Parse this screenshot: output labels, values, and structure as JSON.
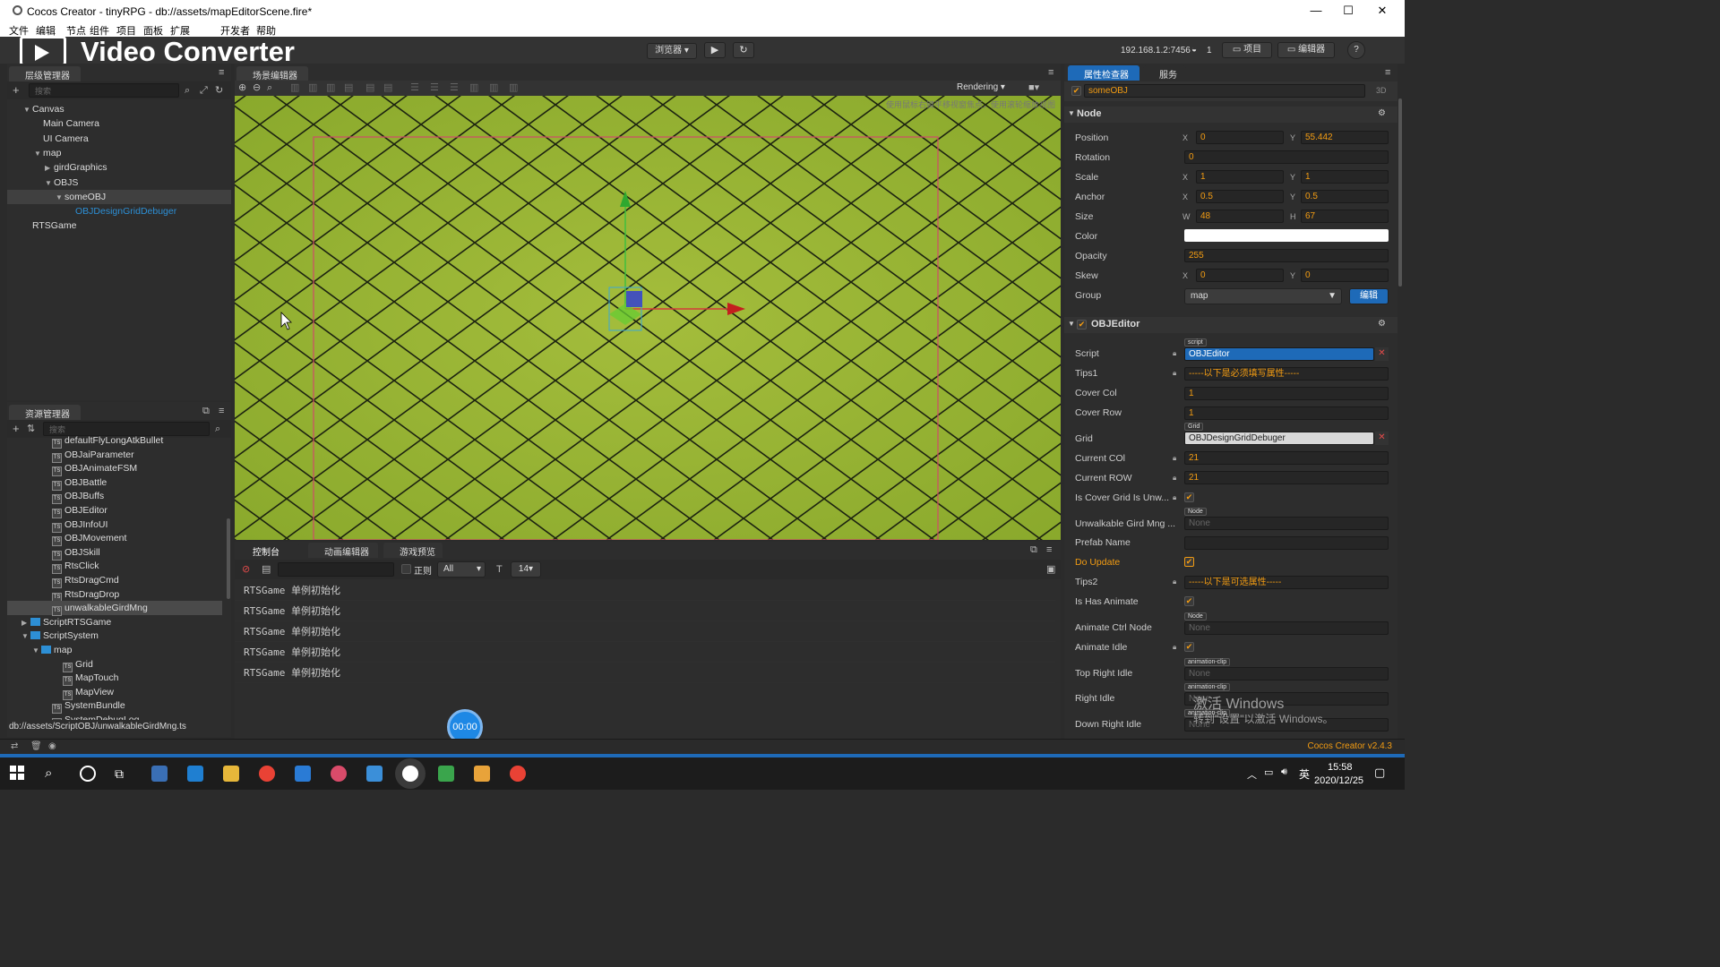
{
  "window": {
    "title": "Cocos Creator - tinyRPG - db://assets/mapEditorScene.fire*",
    "controls": [
      "—",
      "☐",
      "✕"
    ]
  },
  "menu": [
    "文件",
    "编辑",
    "节点",
    "组件",
    "项目",
    "面板",
    "扩展",
    "开发者",
    "帮助"
  ],
  "watermark": "Video Converter",
  "toolbar": {
    "browser_label": "浏览器 ▾",
    "ip": "192.168.1.2:7456",
    "ip_count": "1",
    "project_label": "项目",
    "editor_label": "编辑器",
    "help_label": "?"
  },
  "hierarchy": {
    "tab": "层级管理器",
    "search_placeholder": "搜索",
    "items": [
      {
        "label": "Canvas",
        "depth": 0,
        "arrow": "▼"
      },
      {
        "label": "Main Camera",
        "depth": 1,
        "arrow": ""
      },
      {
        "label": "UI Camera",
        "depth": 1,
        "arrow": ""
      },
      {
        "label": "map",
        "depth": 1,
        "arrow": "▼"
      },
      {
        "label": "girdGraphics",
        "depth": 2,
        "arrow": "▶"
      },
      {
        "label": "OBJS",
        "depth": 2,
        "arrow": "▼"
      },
      {
        "label": "someOBJ",
        "depth": 3,
        "arrow": "▼",
        "selected": true
      },
      {
        "label": "OBJDesignGridDebuger",
        "depth": 4,
        "arrow": "",
        "link": true
      },
      {
        "label": "RTSGame",
        "depth": 0,
        "arrow": ""
      }
    ]
  },
  "assets": {
    "tab": "资源管理器",
    "search_placeholder": "搜索",
    "items": [
      {
        "label": "defaultFlyLongAtkBullet",
        "depth": 3,
        "type": "ts"
      },
      {
        "label": "OBJaiParameter",
        "depth": 3,
        "type": "ts"
      },
      {
        "label": "OBJAnimateFSM",
        "depth": 3,
        "type": "ts"
      },
      {
        "label": "OBJBattle",
        "depth": 3,
        "type": "ts"
      },
      {
        "label": "OBJBuffs",
        "depth": 3,
        "type": "ts"
      },
      {
        "label": "OBJEditor",
        "depth": 3,
        "type": "ts"
      },
      {
        "label": "OBJInfoUI",
        "depth": 3,
        "type": "ts"
      },
      {
        "label": "OBJMovement",
        "depth": 3,
        "type": "ts"
      },
      {
        "label": "OBJSkill",
        "depth": 3,
        "type": "ts"
      },
      {
        "label": "RtsClick",
        "depth": 3,
        "type": "ts"
      },
      {
        "label": "RtsDragCmd",
        "depth": 3,
        "type": "ts"
      },
      {
        "label": "RtsDragDrop",
        "depth": 3,
        "type": "ts"
      },
      {
        "label": "unwalkableGirdMng",
        "depth": 3,
        "type": "ts",
        "selected": true
      },
      {
        "label": "ScriptRTSGame",
        "depth": 1,
        "type": "folder",
        "arrow": "▶"
      },
      {
        "label": "ScriptSystem",
        "depth": 1,
        "type": "folder",
        "arrow": "▼"
      },
      {
        "label": "map",
        "depth": 2,
        "type": "folder",
        "arrow": "▼"
      },
      {
        "label": "Grid",
        "depth": 4,
        "type": "ts"
      },
      {
        "label": "MapTouch",
        "depth": 4,
        "type": "ts"
      },
      {
        "label": "MapView",
        "depth": 4,
        "type": "ts"
      },
      {
        "label": "SystemBundle",
        "depth": 3,
        "type": "ts"
      },
      {
        "label": "SystemDebugLog",
        "depth": 3,
        "type": "ts"
      }
    ],
    "path": "db://assets/ScriptOBJ/unwalkableGirdMng.ts"
  },
  "scene": {
    "tab": "场景编辑器",
    "rendering_label": "Rendering ▾",
    "hint": "使用鼠标右键平移视窗焦点，使用滚轮缩放视图"
  },
  "console": {
    "tabs": [
      "控制台",
      "动画编辑器",
      "游戏预览"
    ],
    "regex_label": "正则",
    "filter": "All",
    "font_size": "14",
    "lines": [
      "RTSGame 单例初始化",
      "RTSGame 单例初始化",
      "RTSGame 单例初始化",
      "RTSGame 单例初始化",
      "RTSGame 单例初始化"
    ],
    "timer": "00:00"
  },
  "inspector": {
    "tab": "属性检查器",
    "tab2": "服务",
    "node_name": "someOBJ",
    "mode": "3D",
    "node_section": "Node",
    "position": {
      "label": "Position",
      "x": "0",
      "y": "55.442"
    },
    "rotation": {
      "label": "Rotation",
      "value": "0"
    },
    "scale": {
      "label": "Scale",
      "x": "1",
      "y": "1"
    },
    "anchor": {
      "label": "Anchor",
      "x": "0.5",
      "y": "0.5"
    },
    "size": {
      "label": "Size",
      "w": "48",
      "h": "67"
    },
    "color": {
      "label": "Color",
      "value": "#ffffff"
    },
    "opacity": {
      "label": "Opacity",
      "value": "255"
    },
    "skew": {
      "label": "Skew",
      "x": "0",
      "y": "0"
    },
    "group": {
      "label": "Group",
      "value": "map",
      "edit": "编辑"
    },
    "component": "OBJEditor",
    "props": {
      "script": {
        "label": "Script",
        "tag": "script",
        "value": "OBJEditor"
      },
      "tips1": {
        "label": "Tips1",
        "value": "-----以下是必须填写属性-----"
      },
      "cover_col": {
        "label": "Cover Col",
        "value": "1"
      },
      "cover_row": {
        "label": "Cover Row",
        "value": "1"
      },
      "grid": {
        "label": "Grid",
        "tag": "Grid",
        "value": "OBJDesignGridDebuger"
      },
      "current_col": {
        "label": "Current COl",
        "value": "21"
      },
      "current_row": {
        "label": "Current ROW",
        "value": "21"
      },
      "is_cover": {
        "label": "Is Cover Grid Is Unw..."
      },
      "unwalkable": {
        "label": "Unwalkable Gird Mng ...",
        "tag": "Node",
        "value": "None"
      },
      "prefab": {
        "label": "Prefab Name",
        "value": ""
      },
      "do_update": {
        "label": "Do Update"
      },
      "tips2": {
        "label": "Tips2",
        "value": "-----以下是可选属性-----"
      },
      "is_has_animate": {
        "label": "Is Has Animate"
      },
      "anim_ctrl": {
        "label": "Animate Ctrl Node",
        "tag": "Node",
        "value": "None"
      },
      "anim_idle": {
        "label": "Animate Idle"
      },
      "top_right": {
        "label": "Top Right Idle",
        "tag": "animation-clip",
        "value": "None"
      },
      "right_idle": {
        "label": "Right Idle",
        "tag": "animation-clip",
        "value": "None"
      },
      "down_right": {
        "label": "Down Right Idle",
        "tag": "animation-clip",
        "value": "None"
      }
    }
  },
  "activation": {
    "line1": "激活 Windows",
    "line2": "转到\"设置\"以激活 Windows。"
  },
  "status": {
    "version": "Cocos Creator v2.4.3"
  },
  "taskbar": {
    "time": "15:58",
    "date": "2020/12/25",
    "ime": "英"
  },
  "colors": {
    "accent": "#1e6ab8",
    "orange": "#f39c12",
    "scene_bg": "#8faf30",
    "link": "#2d8fd5"
  }
}
